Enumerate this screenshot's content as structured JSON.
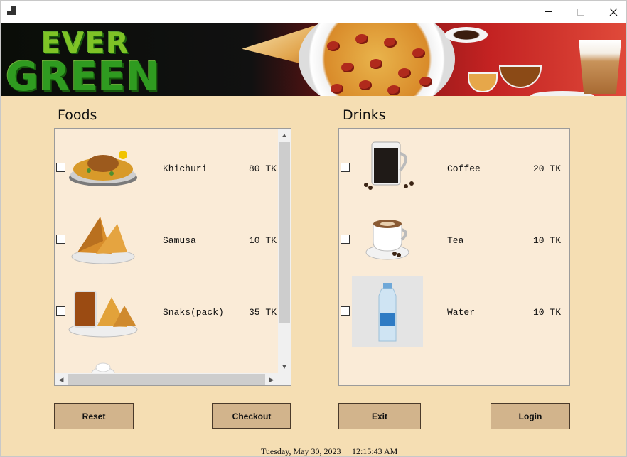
{
  "window": {
    "controls": {
      "minimize": "minimize-icon",
      "maximize": "maximize-icon",
      "close": "close-icon"
    }
  },
  "banner": {
    "logo_line1": "EVER",
    "logo_line2": "GREEN"
  },
  "foods": {
    "title": "Foods",
    "items": [
      {
        "name": "Khichuri",
        "price": "80 TK",
        "checked": false,
        "icon": "khichuri-image"
      },
      {
        "name": "Samusa",
        "price": "10 TK",
        "checked": false,
        "icon": "samusa-image"
      },
      {
        "name": "Snaks(pack)",
        "price": "35 TK",
        "checked": false,
        "icon": "snacks-pack-image"
      },
      {
        "icon": "dessert-image"
      }
    ]
  },
  "drinks": {
    "title": "Drinks",
    "items": [
      {
        "name": "Coffee",
        "price": "20 TK",
        "checked": false,
        "icon": "coffee-image"
      },
      {
        "name": "Tea",
        "price": "10 TK",
        "checked": false,
        "icon": "tea-image"
      },
      {
        "name": "Water",
        "price": "10 TK",
        "checked": false,
        "icon": "water-bottle-image"
      }
    ]
  },
  "buttons": {
    "reset": "Reset",
    "checkout": "Checkout",
    "exit": "Exit",
    "login": "Login"
  },
  "status": {
    "date": "Tuesday, May 30, 2023",
    "time": "12:15:43 AM"
  },
  "colors": {
    "background": "#f5deb3",
    "panel": "#faebd7",
    "button": "#d2b48c"
  }
}
